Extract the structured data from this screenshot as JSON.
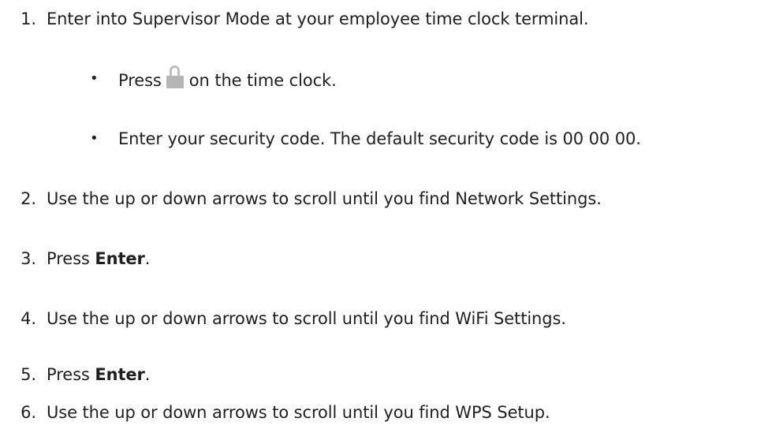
{
  "steps": [
    {
      "number": "1.",
      "text": "Enter into Supervisor Mode at your employee time clock terminal."
    },
    {
      "number": "2.",
      "text": "Use the up or down arrows to scroll until you find Network Settings."
    },
    {
      "number": "3.",
      "prefix": "Press ",
      "bold": "Enter",
      "suffix": "."
    },
    {
      "number": "4.",
      "text": "Use the up or down arrows to scroll until you find WiFi Settings."
    },
    {
      "number": "5.",
      "prefix": "Press ",
      "bold": "Enter",
      "suffix": "."
    },
    {
      "number": "6.",
      "text": "Use the up or down arrows to scroll until you find WPS Setup."
    }
  ],
  "substeps": [
    {
      "bullet": "•",
      "prefix": "Press",
      "icon": "lock-icon",
      "suffix": "on the time clock."
    },
    {
      "bullet": "•",
      "text": "Enter your security code. The default security code is 00 00 00."
    }
  ]
}
